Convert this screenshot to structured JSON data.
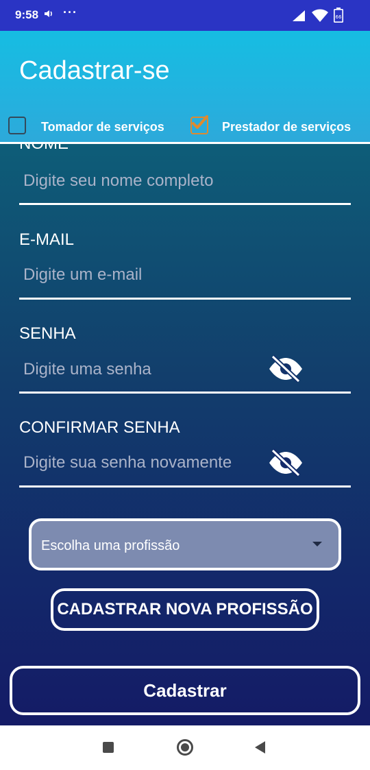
{
  "status_bar": {
    "time": "9:58",
    "dots": "···",
    "battery_level": "66"
  },
  "header": {
    "title": "Cadastrar-se",
    "checkbox_tomador": {
      "label": "Tomador de serviços",
      "checked": false
    },
    "checkbox_prestador": {
      "label": "Prestador de serviços",
      "checked": true
    }
  },
  "form": {
    "nome": {
      "label": "NOME",
      "placeholder": "Digite seu nome completo",
      "value": ""
    },
    "email": {
      "label": "E-MAIL",
      "placeholder": "Digite um e-mail",
      "value": ""
    },
    "senha": {
      "label": "SENHA",
      "placeholder": "Digite uma senha",
      "value": ""
    },
    "confirmar": {
      "label": "CONFIRMAR SENHA",
      "placeholder": "Digite sua senha novamente",
      "value": ""
    },
    "profissao_select": {
      "selected": "Escolha uma profissão"
    },
    "nova_profissao_button": "CADASTRAR NOVA PROFISSÃO",
    "submit_button": "Cadastrar"
  },
  "icons": {
    "password_toggle": "eye-off-icon",
    "nav_back": "square-icon",
    "nav_home": "circle-icon",
    "nav_recent": "triangle-back-icon"
  },
  "colors": {
    "status_bar": "#2a34c4",
    "header_top": "#16bde2",
    "form_top": "#0e5d78",
    "form_bottom": "#141b66",
    "checkbox_checked": "#e08a2e",
    "select_bg": "#7d8bb0"
  }
}
